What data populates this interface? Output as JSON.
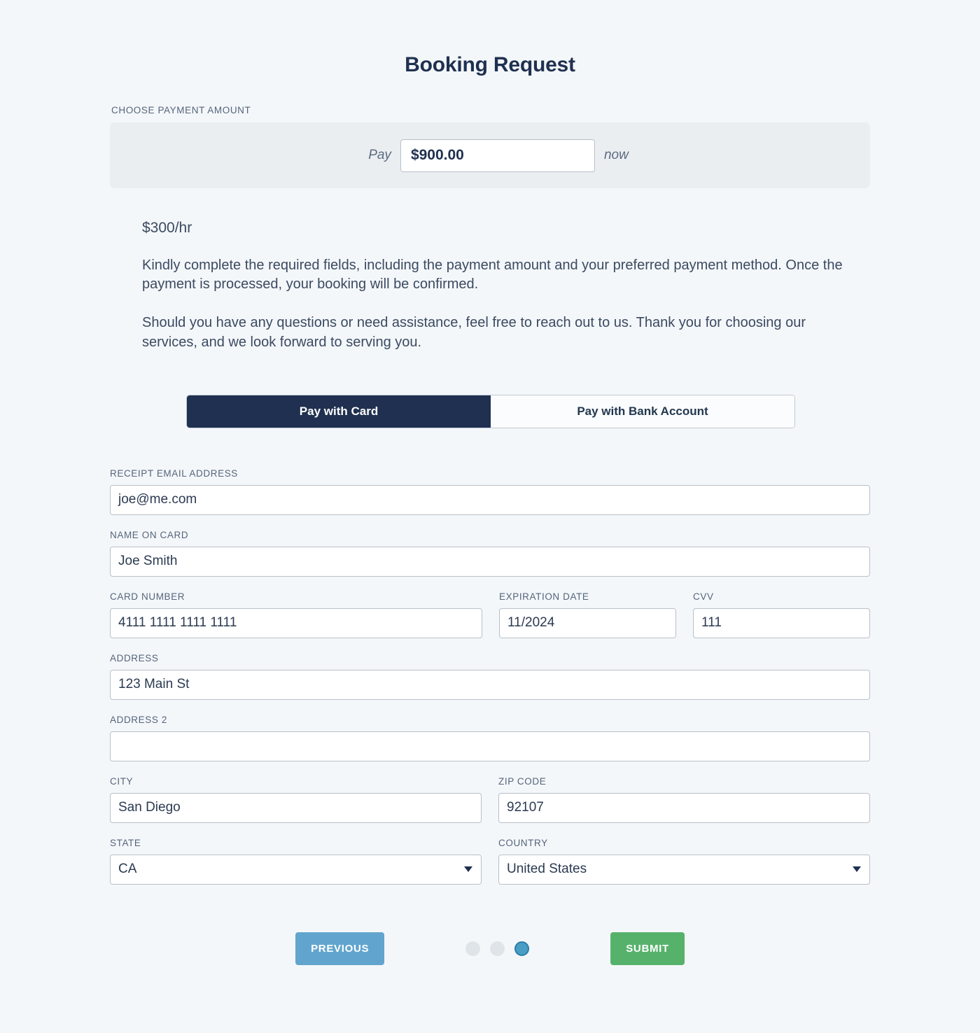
{
  "page": {
    "title": "Booking Request"
  },
  "payment_amount": {
    "section_label": "CHOOSE PAYMENT AMOUNT",
    "prefix_word": "Pay",
    "suffix_word": "now",
    "value": "$900.00"
  },
  "details": {
    "rate": "$300/hr",
    "paragraph_1": "Kindly complete the required fields, including the payment amount and your preferred payment method. Once the payment is processed, your booking will be confirmed.",
    "paragraph_2": "Should you have any questions or need assistance, feel free to reach out to us. Thank you for choosing our services, and we look forward to serving you."
  },
  "method_tabs": [
    {
      "label": "Pay with Card",
      "active": true
    },
    {
      "label": "Pay with Bank Account",
      "active": false
    }
  ],
  "form": {
    "receipt_email": {
      "label": "RECEIPT EMAIL ADDRESS",
      "value": "joe@me.com"
    },
    "name_on_card": {
      "label": "NAME ON CARD",
      "value": "Joe Smith"
    },
    "card_number": {
      "label": "CARD NUMBER",
      "value": "4111 1111 1111 1111"
    },
    "expiration_date": {
      "label": "EXPIRATION DATE",
      "value": "11/2024"
    },
    "cvv": {
      "label": "CVV",
      "value": "111"
    },
    "address": {
      "label": "ADDRESS",
      "value": "123 Main St"
    },
    "address_2": {
      "label": "ADDRESS 2",
      "value": ""
    },
    "city": {
      "label": "CITY",
      "value": "San Diego"
    },
    "zip_code": {
      "label": "ZIP CODE",
      "value": "92107"
    },
    "state": {
      "label": "STATE",
      "value": "CA"
    },
    "country": {
      "label": "COUNTRY",
      "value": "United States"
    }
  },
  "footer": {
    "previous_label": "PREVIOUS",
    "submit_label": "SUBMIT",
    "steps": {
      "total": 3,
      "current": 3
    }
  },
  "colors": {
    "page_background": "#f4f7fa",
    "navy": "#1f3050",
    "panel_gray": "#ebeef1",
    "previous_blue": "#61a5ce",
    "submit_green": "#56b26b",
    "dot_active": "#4a9ec4",
    "dot_inactive": "#dfe4e9"
  }
}
